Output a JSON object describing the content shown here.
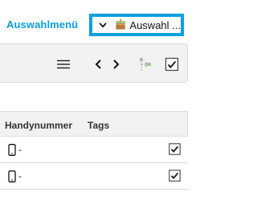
{
  "header": {
    "menu_label": "Auswahlmenü",
    "select_label": "Auswahl ...",
    "select_icon": "cake-icon",
    "accent_color": "#0aa0dc"
  },
  "toolbar": {
    "icons": [
      "hamburger-menu-icon",
      "chevron-left-icon",
      "chevron-right-icon",
      "tree-expand-icon",
      "checkbox-checked-icon"
    ]
  },
  "table": {
    "columns": [
      "Handynummer",
      "Tags"
    ],
    "rows": [
      {
        "phone": "-",
        "phone_icon": "mobile-phone-icon",
        "selected": true
      },
      {
        "phone": "-",
        "phone_icon": "mobile-phone-icon",
        "selected": true
      }
    ]
  }
}
